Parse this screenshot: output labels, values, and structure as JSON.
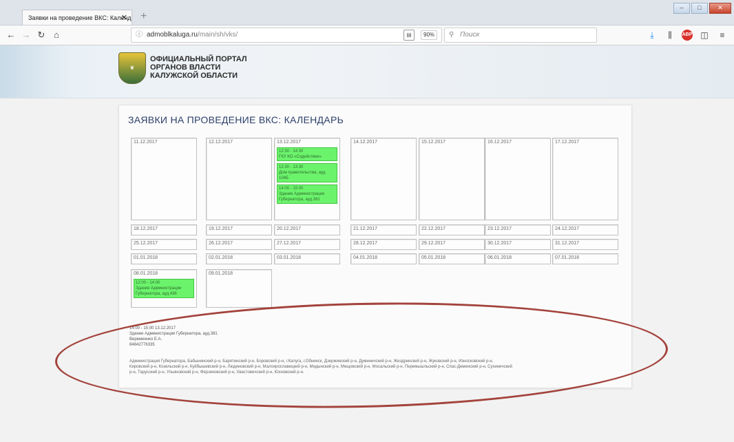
{
  "browser": {
    "tab_title": "Заявки на проведение ВКС: Календ",
    "tab_close": "✕",
    "new_tab": "+",
    "url_host": "admoblkaluga.ru",
    "url_path": "/main/sh/vks/",
    "zoom": "90%",
    "search_placeholder": "Поиск",
    "page_actions": "··· ◉ ☆",
    "window_buttons": [
      "–",
      "□",
      "✕"
    ],
    "icons": {
      "back": "back-arrow-icon",
      "forward": "forward-arrow-icon",
      "reload": "reload-icon",
      "home": "home-icon",
      "info": "info-icon",
      "reader": "reader-view-icon",
      "search": "search-icon",
      "download": "download-icon",
      "library": "library-icon",
      "adblock": "adblock-icon",
      "sidebar": "sidebar-icon",
      "menu": "hamburger-menu-icon"
    }
  },
  "site": {
    "title_lines": [
      "ОФИЦИАЛЬНЫЙ ПОРТАЛ",
      "ОРГАНОВ ВЛАСТИ",
      "КАЛУЖСКОЙ ОБЛАСТИ"
    ]
  },
  "calendar": {
    "title": "ЗАЯВКИ НА ПРОВЕДЕНИЕ ВКС: КАЛЕНДАРЬ",
    "week1": {
      "d1": "11.12.2017",
      "d2": "12.12.2017",
      "d3": "13.12.2017",
      "d4": "14.12.2017",
      "d5": "15.12.2017",
      "d6": "16.12.2017",
      "d7": "17.12.2017",
      "events": [
        {
          "time": "12:30 - 14:30",
          "place": "ГКУ КО «Содействие»"
        },
        {
          "time": "12:30 - 13:30",
          "place": "Дом правительства, ауд.",
          "place2": "104Б"
        },
        {
          "time": "14:00 - 15:00",
          "place": "Здание Администрации",
          "place2": "Губернатора, ауд.381"
        }
      ]
    },
    "week2": [
      "18.12.2017",
      "19.12.2017",
      "20.12.2017",
      "21.12.2017",
      "22.12.2017",
      "23.12.2017",
      "24.12.2017"
    ],
    "week3": [
      "25.12.2017",
      "26.12.2017",
      "27.12.2017",
      "28.12.2017",
      "29.12.2017",
      "30.12.2017",
      "31.12.2017"
    ],
    "week4": [
      "01.01.2018",
      "02.01.2018",
      "03.01.2018",
      "04.01.2018",
      "05.01.2018",
      "06.01.2018",
      "07.01.2018"
    ],
    "week5": {
      "d1": "08.01.2018",
      "d2": "09.01.2018",
      "event": {
        "time": "12:00 - 14:00",
        "place": "Здание Администрации",
        "place2": "Губернатора, ауд.436"
      }
    }
  },
  "details": {
    "line1": "14:00 - 15:00 13.12.2017",
    "line2": "Здание Администрации Губернатора, ауд.381",
    "line3": "Веремеенко Е.А.",
    "line4": "84842776335"
  },
  "regions": {
    "line1": "Администрация Губернатора, Бабынинский р-н, Барятинский р-н, Боровский р-н, г.Калуга, г.Обнинск, Дзержинский р-н, Думиничский р-н, Жиздринский р-н, Жуковский р-н, Износковский р-н,",
    "line2": "Кировский р-н, Козельский р-н, Куйбышевский р-н, Людиновский р-н, Малоярославецкий р-н, Медынский р-н, Мещовский р-н, Мосальский р-н, Перемышльский р-н, Спас-Деменский р-н, Сухиничский",
    "line3": "р-н, Тарусский р-н, Ульяновский р-н, Ферзиковский р-н, Хвастовичский р-н, Юхновский р-н."
  },
  "colors": {
    "event_bg": "#6cf36c",
    "title": "#2b3f6a",
    "annotation": "#a3433c"
  }
}
